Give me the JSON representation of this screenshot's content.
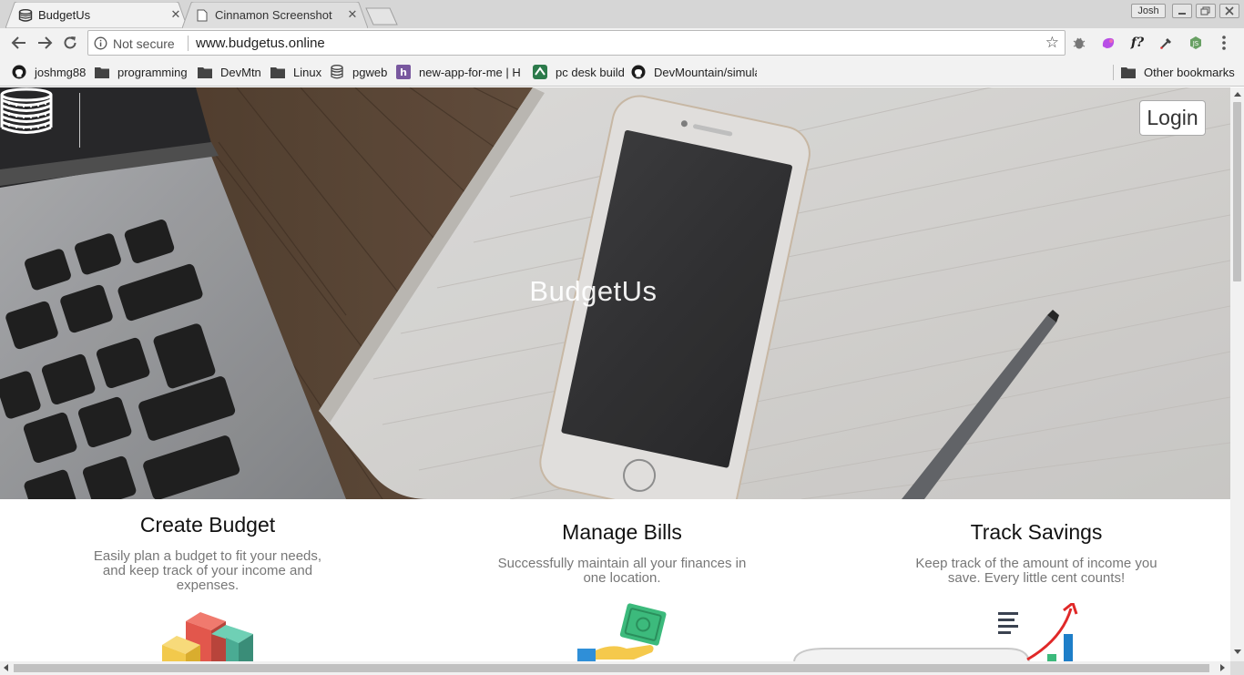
{
  "browser": {
    "tabs": [
      {
        "title": "BudgetUs",
        "active": true
      },
      {
        "title": "Cinnamon Screenshot S",
        "active": false
      }
    ],
    "tab_close_glyph": "✕",
    "profile_name": "Josh",
    "url_security": "Not secure",
    "url": "www.budgetus.online",
    "extensions": [
      "bug-icon",
      "paint-icon",
      "font-finder-icon",
      "eyedropper-icon",
      "node-icon"
    ],
    "extension_font_label": "f?",
    "bookmarks": [
      {
        "label": "joshmg88",
        "icon": "github-icon"
      },
      {
        "label": "programming",
        "icon": "folder-icon"
      },
      {
        "label": "DevMtn",
        "icon": "folder-icon"
      },
      {
        "label": "Linux",
        "icon": "folder-icon"
      },
      {
        "label": "pgweb",
        "icon": "database-icon"
      },
      {
        "label": "new-app-for-me | H",
        "icon": "heroku-icon"
      },
      {
        "label": "pc desk build",
        "icon": "pcpartpicker-icon"
      },
      {
        "label": "DevMountain/simula",
        "icon": "github-icon"
      }
    ],
    "other_bookmarks": "Other bookmarks"
  },
  "site": {
    "hero_title": "BudgetUs",
    "login_label": "Login",
    "features": [
      {
        "title": "Create Budget",
        "description": "Easily plan a budget to fit your needs, and keep track of your income and expenses."
      },
      {
        "title": "Manage Bills",
        "description": "Successfully maintain all your finances in one location."
      },
      {
        "title": "Track Savings",
        "description": "Keep track of the amount of income you save. Every little cent counts!"
      }
    ]
  },
  "colors": {
    "accent_red": "#e2574c",
    "accent_teal": "#4aab93",
    "accent_yellow": "#f2c94c",
    "money_green": "#3cba7c",
    "chart_blue": "#1e7ec8"
  }
}
